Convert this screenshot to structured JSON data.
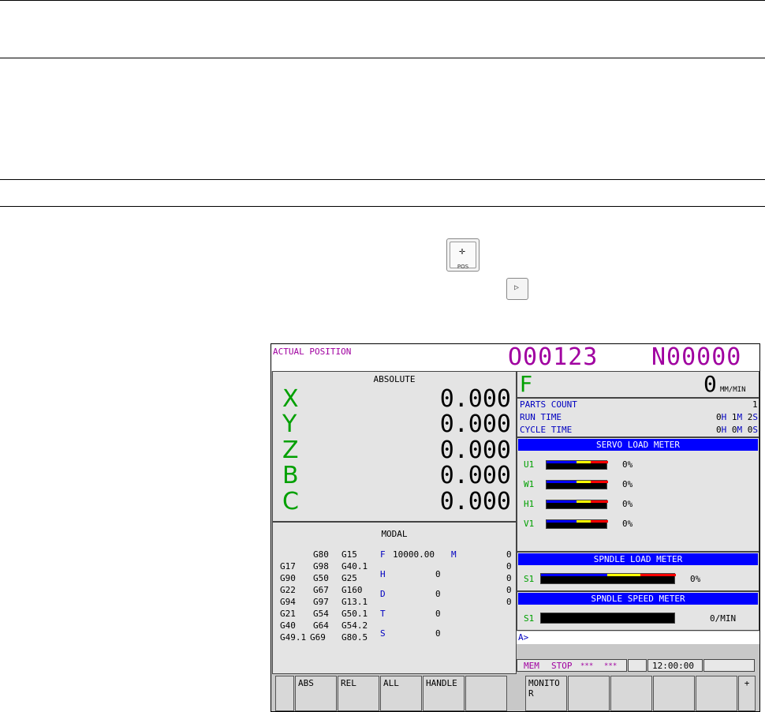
{
  "doc_icons": {
    "pos_key_label": "POS"
  },
  "cnc": {
    "title": "ACTUAL POSITION",
    "program_number": "O00123",
    "sequence_number": "N00000",
    "absolute": {
      "title": "ABSOLUTE",
      "axes": [
        {
          "name": "X",
          "value": "0.000"
        },
        {
          "name": "Y",
          "value": "0.000"
        },
        {
          "name": "Z",
          "value": "0.000"
        },
        {
          "name": "B",
          "value": "0.000"
        },
        {
          "name": "C",
          "value": "0.000"
        }
      ]
    },
    "feed": {
      "label": "F",
      "value": "0",
      "unit": "MM/MIN"
    },
    "counts": {
      "parts_label": "PARTS COUNT",
      "parts_value": "1",
      "run_label": "RUN TIME",
      "run": {
        "h": "0",
        "hl": "H",
        "m": "1",
        "ml": "M",
        "s": "2",
        "sl": "S"
      },
      "cycle_label": "CYCLE TIME",
      "cycle": {
        "h": "0",
        "hl": "H",
        "m": "0",
        "ml": "M",
        "s": "0",
        "sl": "S"
      }
    },
    "servo": {
      "title": "SERVO LOAD METER",
      "rows": [
        {
          "axis": "U1",
          "percent": "0%"
        },
        {
          "axis": "W1",
          "percent": "0%"
        },
        {
          "axis": "H1",
          "percent": "0%"
        },
        {
          "axis": "V1",
          "percent": "0%"
        }
      ]
    },
    "spindle_load": {
      "title": "SPNDLE LOAD METER",
      "axis": "S1",
      "percent": "0%"
    },
    "spindle_speed": {
      "title": "SPNDLE SPEED METER",
      "axis": "S1",
      "value": "0/MIN"
    },
    "modal": {
      "title": "MODAL",
      "gcodes": [
        [
          "",
          "G80",
          "G15"
        ],
        [
          "G17",
          "G98",
          "G40.1"
        ],
        [
          "G90",
          "G50",
          "G25"
        ],
        [
          "G22",
          "G67",
          "G160"
        ],
        [
          "G94",
          "G97",
          "G13.1"
        ],
        [
          "G21",
          "G54",
          "G50.1"
        ],
        [
          "G40",
          "G64",
          "G54.2"
        ],
        [
          "G49.1",
          "G69",
          "G80.5"
        ]
      ],
      "f_label": "F",
      "f_value": "10000.00",
      "m_label": "M",
      "m_values": [
        "0",
        "0",
        "0",
        "0",
        "0"
      ],
      "h_label": "H",
      "h_value": "0",
      "d_label": "D",
      "d_value": "0",
      "t_label": "T",
      "t_value": "0",
      "s_label": "S",
      "s_value": "0"
    },
    "input_prompt": "A>",
    "status": {
      "mode": "MEM",
      "state": "STOP",
      "stars1": "***",
      "stars2": "***",
      "time": "12:00:00"
    },
    "softkeys": [
      "ABS",
      "REL",
      "ALL",
      "HANDLE",
      "",
      "MONITO\nR",
      "",
      "",
      "",
      "",
      "+"
    ]
  }
}
